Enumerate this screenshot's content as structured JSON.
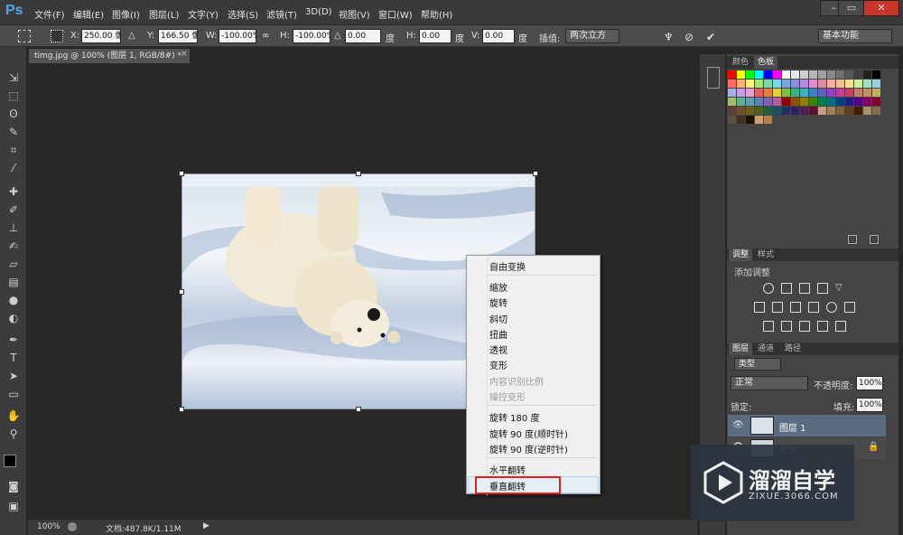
{
  "app": {
    "logo": "Ps"
  },
  "menu": [
    "文件(F)",
    "编辑(E)",
    "图像(I)",
    "图层(L)",
    "文字(Y)",
    "选择(S)",
    "滤镜(T)",
    "3D(D)",
    "视图(V)",
    "窗口(W)",
    "帮助(H)"
  ],
  "window_controls": {
    "minimize": "–",
    "restore": "▭",
    "close": "✕"
  },
  "options": {
    "x_label": "X:",
    "x_value": "250.00 像",
    "y_label": "Y:",
    "y_value": "166.50 像",
    "w_label": "W:",
    "w_value": "-100.00%",
    "h_label": "H:",
    "h_value": "-100.00%",
    "angle_value": "0.00",
    "angle_unit": "度",
    "hskew_label": "H:",
    "hskew_value": "0.00",
    "hskew_unit": "度",
    "vskew_label": "V:",
    "vskew_value": "0.00",
    "vskew_unit": "度",
    "interp_label": "插值:",
    "interp_value": "两次立方",
    "workspace": "基本功能"
  },
  "document": {
    "tab_title": "timg.jpg @ 100% (图层 1, RGB/8#) *",
    "close": "×"
  },
  "status": {
    "zoom": "100%",
    "doc_info": "文档:487.8K/1.11M"
  },
  "swatch_panel": {
    "tabs": [
      "颜色",
      "色板"
    ],
    "colors": [
      "#ff0000",
      "#ffff00",
      "#00ff00",
      "#00ffff",
      "#0000ff",
      "#ff00ff",
      "#ffffff",
      "#e6e6e6",
      "#d0d0d0",
      "#b8b8b8",
      "#a0a0a0",
      "#888888",
      "#707070",
      "#585858",
      "#404040",
      "#202020",
      "#000000",
      "#ff6a6a",
      "#ffb070",
      "#fff080",
      "#a4e27a",
      "#7ed7a8",
      "#7cd6e6",
      "#7ca6e0",
      "#8c8ce0",
      "#b48ce0",
      "#e08cd0",
      "#e08ca0",
      "#f0b0a0",
      "#f0c090",
      "#f0e090",
      "#d0f0a0",
      "#a0e0c0",
      "#a0d0e0",
      "#a0b0e0",
      "#c0a0e0",
      "#e0a0d0",
      "#e06060",
      "#e08040",
      "#e0d040",
      "#80c040",
      "#40b080",
      "#40b0c0",
      "#4080c0",
      "#6060c0",
      "#9040c0",
      "#c040a0",
      "#c04060",
      "#c08070",
      "#c09060",
      "#c0b060",
      "#a0c070",
      "#60b090",
      "#60a0b0",
      "#6080b0",
      "#8060b0",
      "#b060a0",
      "#900000",
      "#905000",
      "#908000",
      "#408000",
      "#008050",
      "#007080",
      "#004080",
      "#202080",
      "#500080",
      "#800060",
      "#800030",
      "#604030",
      "#705030",
      "#706020",
      "#506020",
      "#206040",
      "#205060",
      "#203060",
      "#302060",
      "#502050",
      "#601030",
      "#c0a080",
      "#a08060",
      "#806040",
      "#604020",
      "#402000",
      "#a09070",
      "#807050",
      "#605040",
      "#403020",
      "#201000",
      "#d0a070",
      "#b08050"
    ]
  },
  "adjust_panel": {
    "tabs": [
      "调整",
      "样式"
    ],
    "title": "添加调整"
  },
  "layers_panel": {
    "tabs": [
      "图层",
      "通道",
      "路径"
    ],
    "filter": "类型",
    "blend_mode": "正常",
    "opacity_label": "不透明度:",
    "opacity_value": "100%",
    "lock_label": "锁定:",
    "fill_label": "填充:",
    "fill_value": "100%",
    "layers": [
      {
        "name": "图层 1"
      },
      {
        "name": "背景"
      }
    ]
  },
  "context_menu": {
    "items": [
      {
        "label": "自由变换",
        "enabled": true
      },
      {
        "label": "缩放",
        "enabled": true
      },
      {
        "label": "旋转",
        "enabled": true
      },
      {
        "label": "斜切",
        "enabled": true
      },
      {
        "label": "扭曲",
        "enabled": true
      },
      {
        "label": "透视",
        "enabled": true
      },
      {
        "label": "变形",
        "enabled": true
      },
      {
        "label": "内容识别比例",
        "enabled": false
      },
      {
        "label": "操控变形",
        "enabled": false
      },
      {
        "label": "旋转 180 度",
        "enabled": true
      },
      {
        "label": "旋转 90 度(顺时针)",
        "enabled": true
      },
      {
        "label": "旋转 90 度(逆时针)",
        "enabled": true
      },
      {
        "label": "水平翻转",
        "enabled": true
      },
      {
        "label": "垂直翻转",
        "enabled": true
      }
    ]
  },
  "watermark": {
    "brand": "溜溜自学",
    "url": "ZIXUE.3066.COM"
  }
}
